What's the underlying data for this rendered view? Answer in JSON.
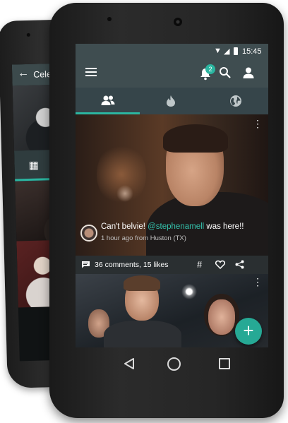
{
  "back_phone": {
    "back_arrow_glyph": "←",
    "title": "Celebrity",
    "grid_icon_glyph": "▦"
  },
  "statusbar": {
    "wifi_glyph": "▼",
    "signal_glyph": "◢",
    "time": "15:45"
  },
  "appbar": {
    "notification_count": "2"
  },
  "tabs": [
    {
      "icon": "people-icon",
      "active": true
    },
    {
      "icon": "flame-icon",
      "active": false
    },
    {
      "icon": "globe-icon",
      "active": false
    }
  ],
  "post": {
    "caption_before": "Can't belvie! ",
    "mention": "@stephenamell",
    "caption_after": " was here!!",
    "meta": "1 hour ago from Huston (TX)",
    "stats": "36 comments, 15 likes",
    "more_glyph": "⋮",
    "hash_glyph": "#"
  },
  "fab": {
    "glyph": "+"
  },
  "colors": {
    "accent": "#2bb5a0",
    "appbar": "#3f4d50",
    "tabbar": "#36454a",
    "mention": "#34c2ac"
  }
}
